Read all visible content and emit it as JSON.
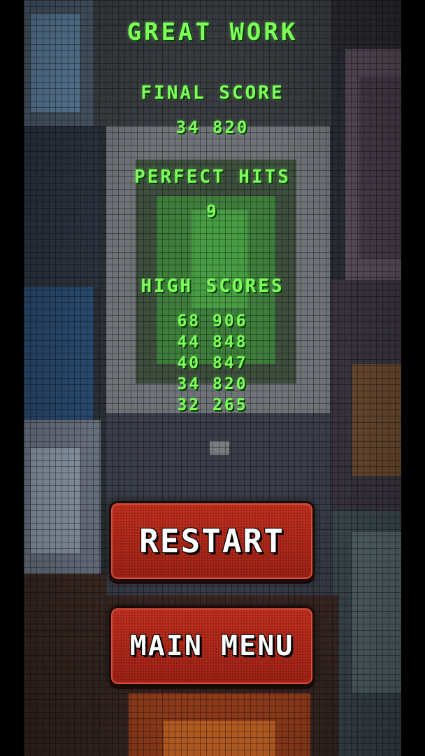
{
  "game_over": {
    "title": "GREAT WORK",
    "final_score_label": "FINAL SCORE",
    "final_score_value": "34 820",
    "perfect_hits_label": "PERFECT HITS",
    "perfect_hits_value": "9",
    "high_scores_label": "HIGH SCORES",
    "high_scores": [
      "68 906",
      "44 848",
      "40 847",
      "34 820",
      "32 265"
    ]
  },
  "buttons": {
    "restart_label": "RESTART",
    "main_menu_label": "MAIN MENU"
  },
  "colors": {
    "text_green": "#7dff5a",
    "button_red": "#b52a1c",
    "button_text": "#ffffff",
    "letterbox": "#000000"
  }
}
